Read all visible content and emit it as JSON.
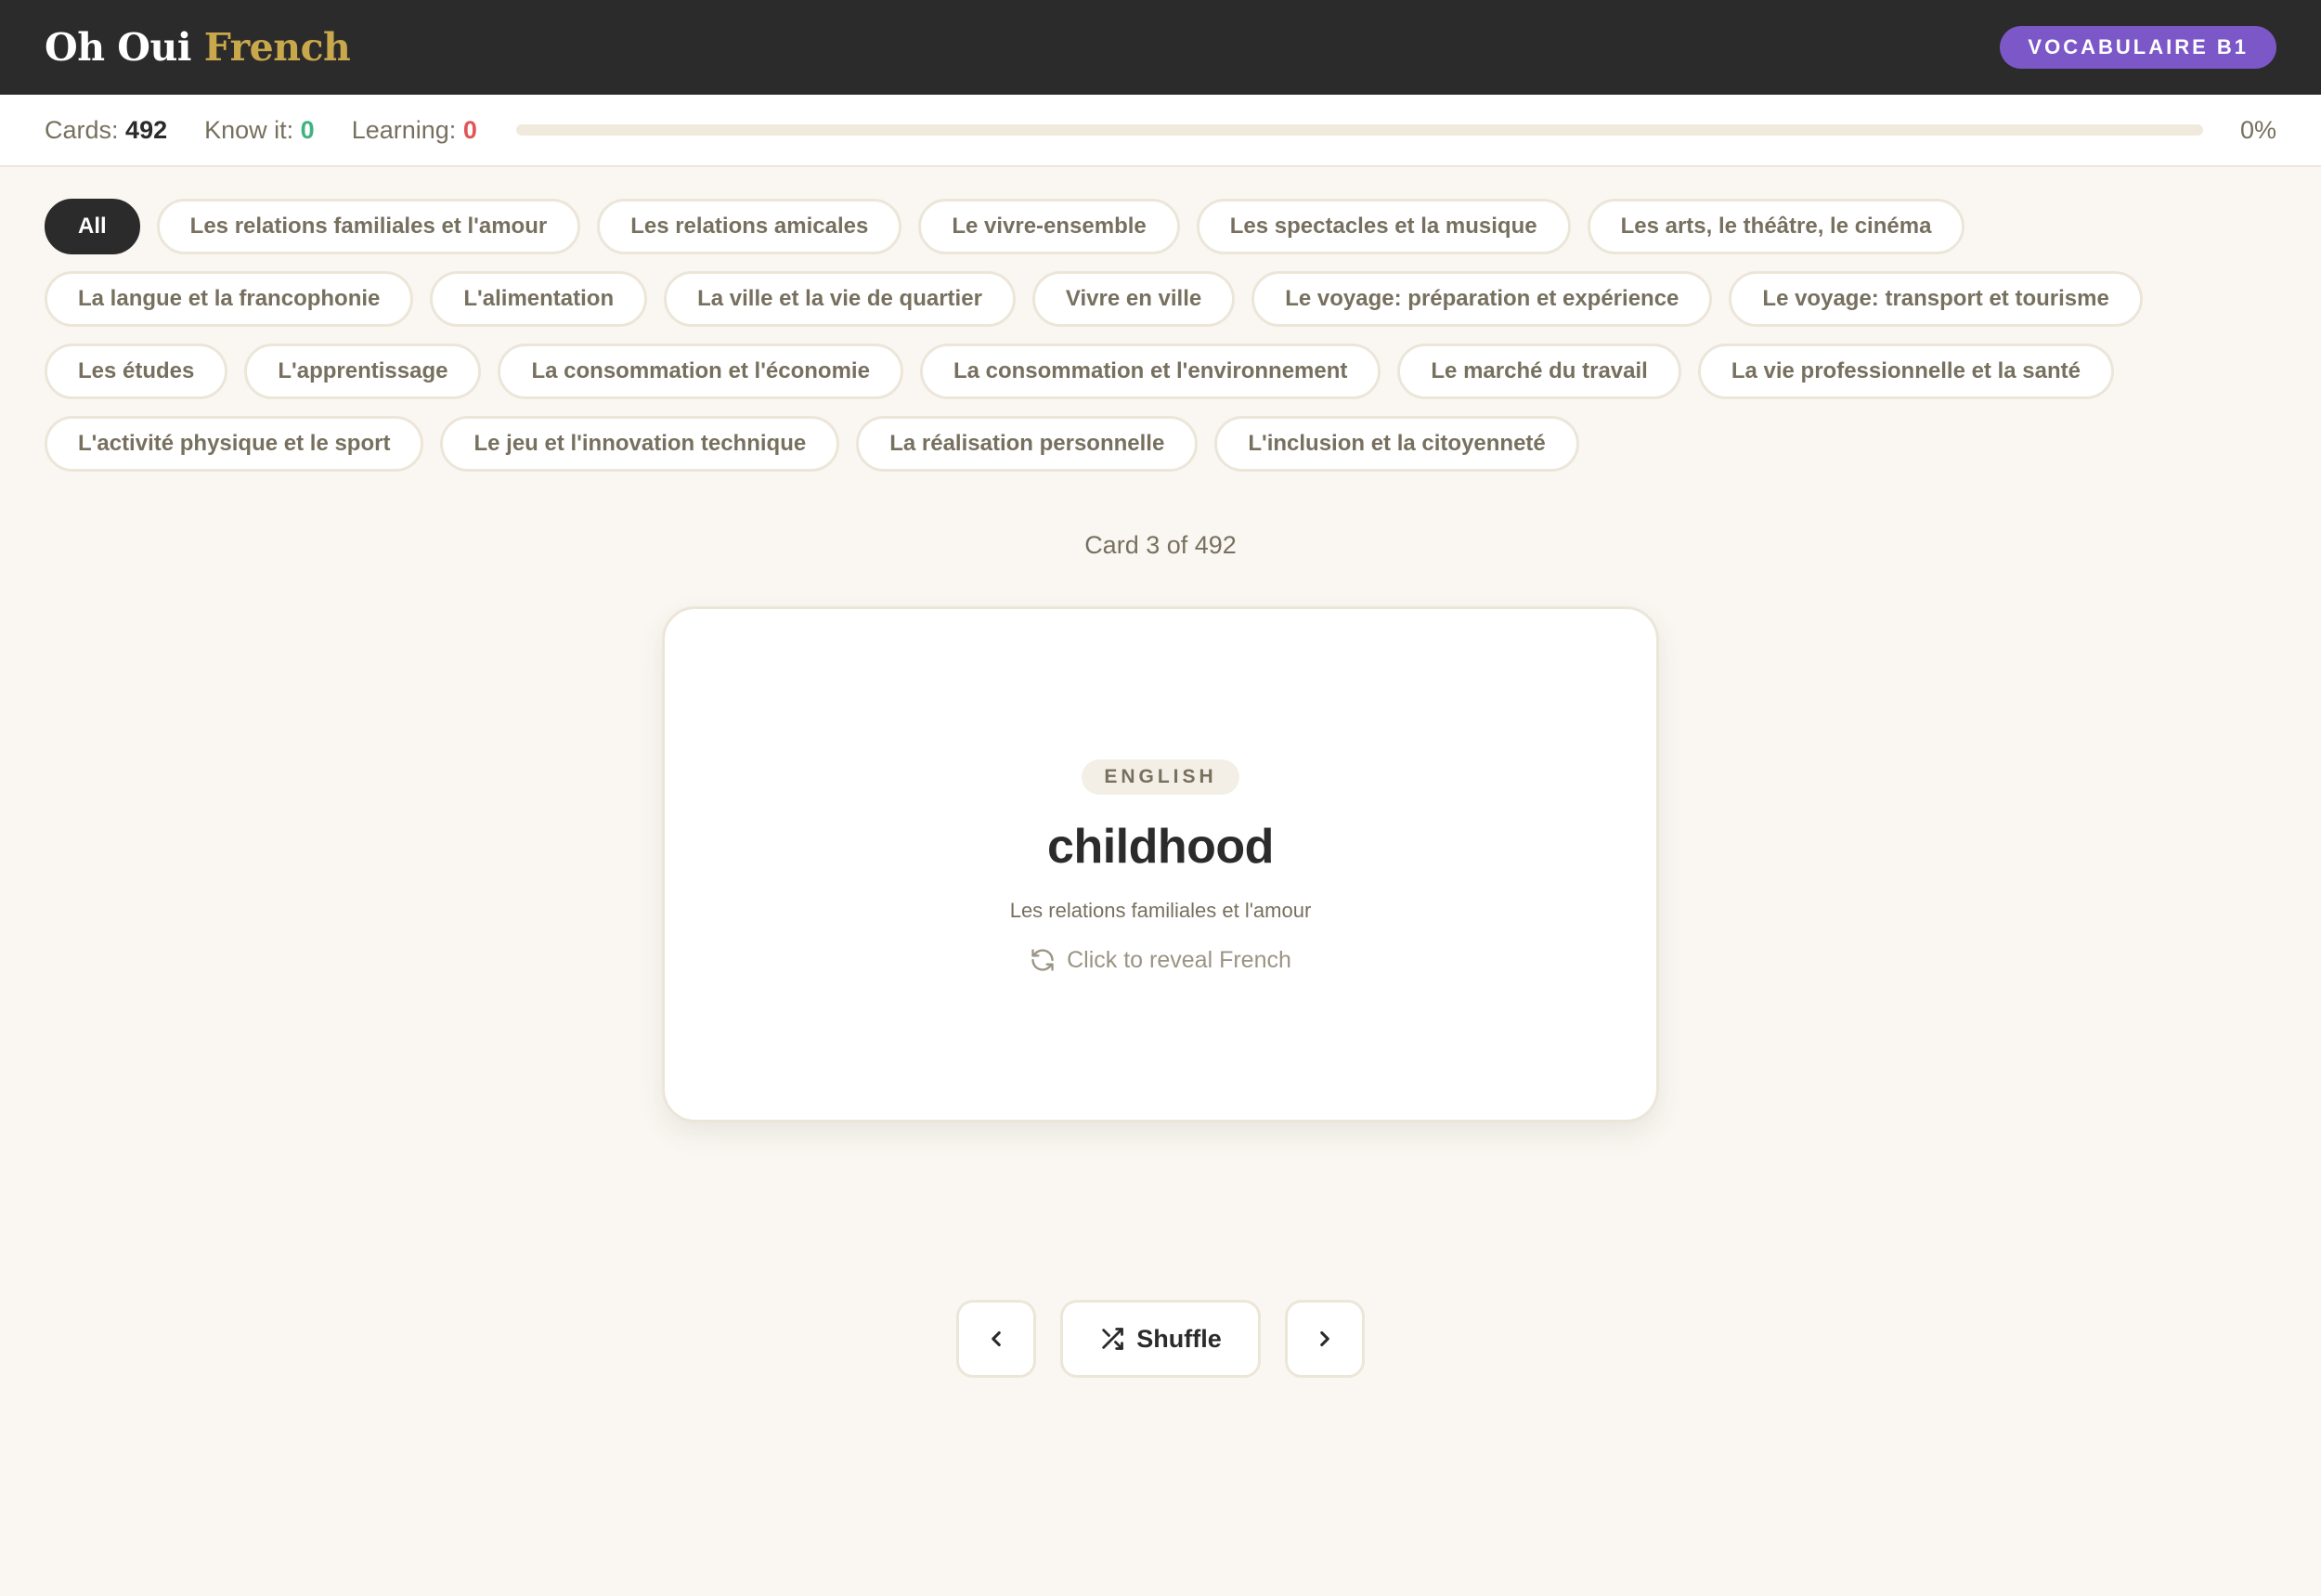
{
  "header": {
    "brand_main": "Oh Oui",
    "brand_accent": "French",
    "level_badge": "VOCABULAIRE B1"
  },
  "stats": {
    "cards_label": "Cards:",
    "cards_value": "492",
    "know_label": "Know it:",
    "know_value": "0",
    "learning_label": "Learning:",
    "learning_value": "0",
    "progress_percent_text": "0%",
    "progress_fraction": 0
  },
  "categories": [
    {
      "label": "All",
      "active": true
    },
    {
      "label": "Les relations familiales et l'amour",
      "active": false
    },
    {
      "label": "Les relations amicales",
      "active": false
    },
    {
      "label": "Le vivre-ensemble",
      "active": false
    },
    {
      "label": "Les spectacles et la musique",
      "active": false
    },
    {
      "label": "Les arts, le théâtre, le cinéma",
      "active": false
    },
    {
      "label": "La langue et la francophonie",
      "active": false
    },
    {
      "label": "L'alimentation",
      "active": false
    },
    {
      "label": "La ville et la vie de quartier",
      "active": false
    },
    {
      "label": "Vivre en ville",
      "active": false
    },
    {
      "label": "Le voyage: préparation et expérience",
      "active": false
    },
    {
      "label": "Le voyage: transport et tourisme",
      "active": false
    },
    {
      "label": "Les études",
      "active": false
    },
    {
      "label": "L'apprentissage",
      "active": false
    },
    {
      "label": "La consommation et l'économie",
      "active": false
    },
    {
      "label": "La consommation et l'environnement",
      "active": false
    },
    {
      "label": "Le marché du travail",
      "active": false
    },
    {
      "label": "La vie professionnelle et la santé",
      "active": false
    },
    {
      "label": "L'activité physique et le sport",
      "active": false
    },
    {
      "label": "Le jeu et l'innovation technique",
      "active": false
    },
    {
      "label": "La réalisation personnelle",
      "active": false
    },
    {
      "label": "L'inclusion et la citoyenneté",
      "active": false
    }
  ],
  "card": {
    "counter_text": "Card 3 of 492",
    "language_label": "ENGLISH",
    "word": "childhood",
    "category": "Les relations familiales et l'amour",
    "reveal_hint": "Click to reveal French"
  },
  "controls": {
    "shuffle_label": "Shuffle"
  },
  "icons": {
    "reveal": "refresh-icon",
    "previous": "chevron-left-icon",
    "next": "chevron-right-icon",
    "shuffle": "shuffle-icon"
  },
  "colors": {
    "header_bg": "#2b2b2b",
    "brand_accent": "#c9a84c",
    "level_badge": "#7c57c8",
    "know_green": "#3fb27f",
    "learning_red": "#e05555"
  }
}
